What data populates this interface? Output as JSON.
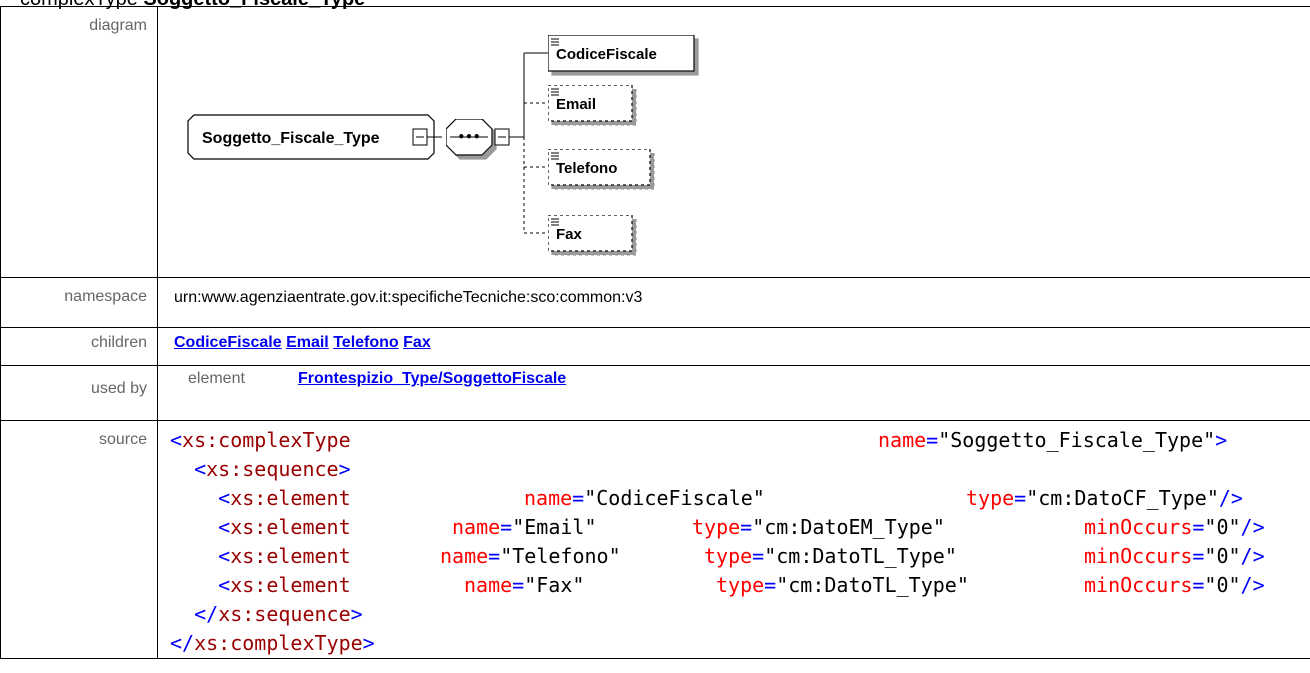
{
  "header": {
    "prefix": "complexType ",
    "name": "Soggetto_Fiscale_Type"
  },
  "labels": {
    "diagram": "diagram",
    "namespace": "namespace",
    "children": "children",
    "used_by": "used by",
    "source": "source"
  },
  "diagram": {
    "type_name": "Soggetto_Fiscale_Type",
    "sequence_symbol": "•••",
    "elements": [
      {
        "name": "CodiceFiscale",
        "optional": false
      },
      {
        "name": "Email",
        "optional": true
      },
      {
        "name": "Telefono",
        "optional": true
      },
      {
        "name": "Fax",
        "optional": true
      }
    ]
  },
  "namespace": "urn:www.agenziaentrate.gov.it:specificheTecniche:sco:common:v3",
  "children": [
    "CodiceFiscale",
    "Email",
    "Telefono",
    "Fax"
  ],
  "used_by": {
    "kind": "element",
    "target": "Frontespizio_Type/SoggettoFiscale"
  },
  "source": {
    "line1": {
      "open": "<",
      "tag": "xs:complexType",
      "attr": "name",
      "eq": "=",
      "val": "\"Soggetto_Fiscale_Type\"",
      "close": ">"
    },
    "line2": {
      "open": "<",
      "tag": "xs:sequence",
      "close": ">"
    },
    "line3": {
      "open": "<",
      "tag": "xs:element",
      "attr1": "name",
      "val1": "\"CodiceFiscale\"",
      "attr2": "type",
      "val2": "\"cm:DatoCF_Type\"",
      "close": "/>"
    },
    "line4": {
      "open": "<",
      "tag": "xs:element",
      "attr1": "name",
      "val1": "\"Email\"",
      "attr2": "type",
      "val2": "\"cm:DatoEM_Type\"",
      "attr3": "minOccurs",
      "val3": "\"0\"",
      "close": "/>"
    },
    "line5": {
      "open": "<",
      "tag": "xs:element",
      "attr1": "name",
      "val1": "\"Telefono\"",
      "attr2": "type",
      "val2": "\"cm:DatoTL_Type\"",
      "attr3": "minOccurs",
      "val3": "\"0\"",
      "close": "/>"
    },
    "line6": {
      "open": "<",
      "tag": "xs:element",
      "attr1": "name",
      "val1": "\"Fax\"",
      "attr2": "type",
      "val2": "\"cm:DatoTL_Type\"",
      "attr3": "minOccurs",
      "val3": "\"0\"",
      "close": "/>"
    },
    "line7": {
      "open": "</",
      "tag": "xs:sequence",
      "close": ">"
    },
    "line8": {
      "open": "</",
      "tag": "xs:complexType",
      "close": ">"
    }
  },
  "colors": {
    "tag": "#0000ff",
    "element_name": "#990000",
    "attribute": "#ff0000",
    "link": "#0000ee",
    "label": "#666666"
  }
}
